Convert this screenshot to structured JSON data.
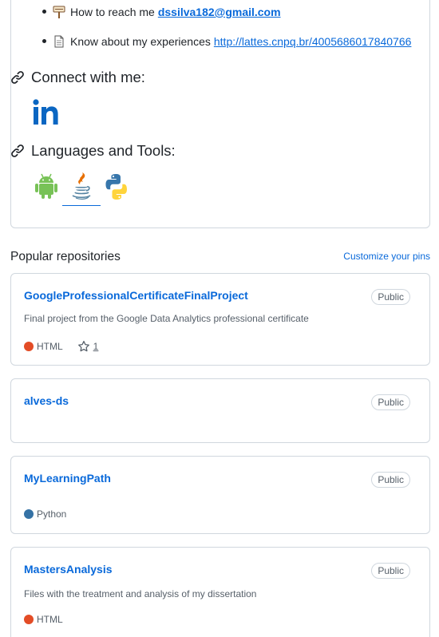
{
  "readme": {
    "bullets": [
      {
        "icon": "signpost-emoji",
        "text": "How to reach me",
        "link": "dssilva182@gmail.com"
      },
      {
        "icon": "page-emoji",
        "text": "Know about my experiences",
        "link": "http://lattes.cnpq.br/4005686017840766"
      }
    ],
    "connect_heading": "Connect with me:",
    "languages_heading": "Languages and Tools:",
    "social_icons": [
      "linkedin-icon"
    ],
    "tool_icons": [
      "android-icon",
      "java-icon",
      "python-icon"
    ]
  },
  "popular": {
    "title": "Popular repositories",
    "customize_label": "Customize your pins"
  },
  "repos": [
    {
      "name": "GoogleProfessionalCertificateFinalProject",
      "visibility": "Public",
      "description": "Final project from the Google Data Analytics professional certificate",
      "language": "HTML",
      "language_color": "#e34c26",
      "stars": "1"
    },
    {
      "name": "alves-ds",
      "visibility": "Public",
      "description": "",
      "language": "",
      "language_color": "",
      "stars": ""
    },
    {
      "name": "MyLearningPath",
      "visibility": "Public",
      "description": "",
      "language": "Python",
      "language_color": "#3572A5",
      "stars": ""
    },
    {
      "name": "MastersAnalysis",
      "visibility": "Public",
      "description": "Files with the treatment and analysis of my dissertation",
      "language": "HTML",
      "language_color": "#e34c26",
      "stars": ""
    }
  ],
  "colors": {
    "link": "#0969da",
    "border": "#d0d7de",
    "muted": "#57606a"
  }
}
